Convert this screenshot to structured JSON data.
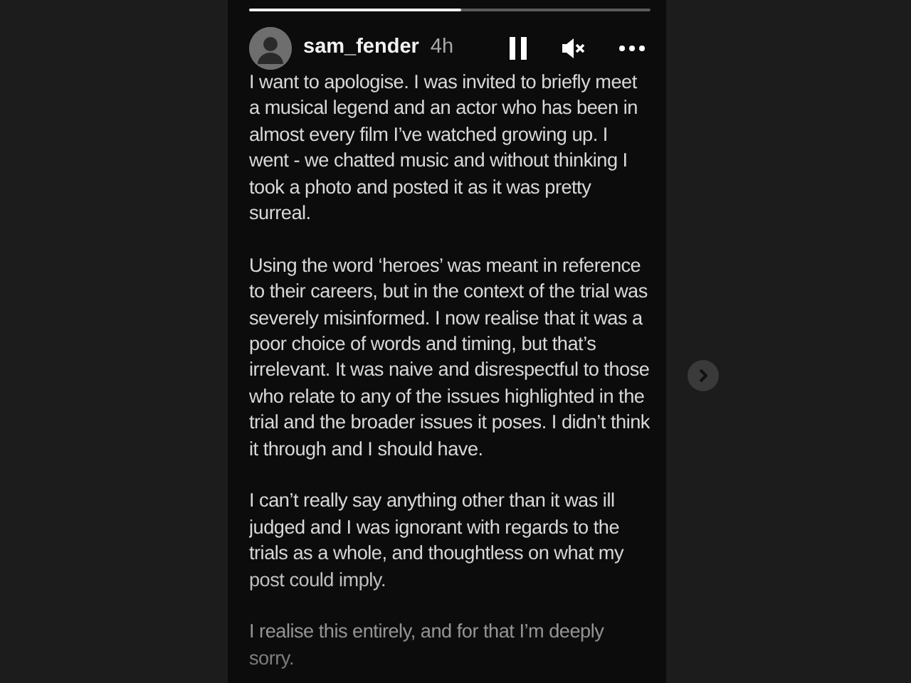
{
  "story": {
    "progress": [
      {
        "level": 0.53
      }
    ],
    "user": {
      "name": "sam_fender",
      "time": "4h"
    },
    "paused": false,
    "muted": true,
    "paragraphs": [
      "I want to apologise. I was invited to briefly meet a musical legend and an actor who has been in almost every film I’ve watched growing up. I went - we chatted music and without thinking I took a photo and posted it as it was pretty surreal.",
      "Using the word ‘heroes’ was meant in reference to their careers, but in the context of the trial was severely misinformed. I now realise that it was a poor choice of words and timing, but that’s irrelevant. It was naive and disrespectful to those who relate to any of the issues highlighted in the trial and the broader issues it poses. I didn’t think it through and I should have.",
      "I can’t really say anything other than it was ill judged and I was ignorant with regards to the trials as a whole, and thoughtless on what my post could imply.",
      "I realise this entirely, and for that I’m deeply sorry."
    ]
  }
}
